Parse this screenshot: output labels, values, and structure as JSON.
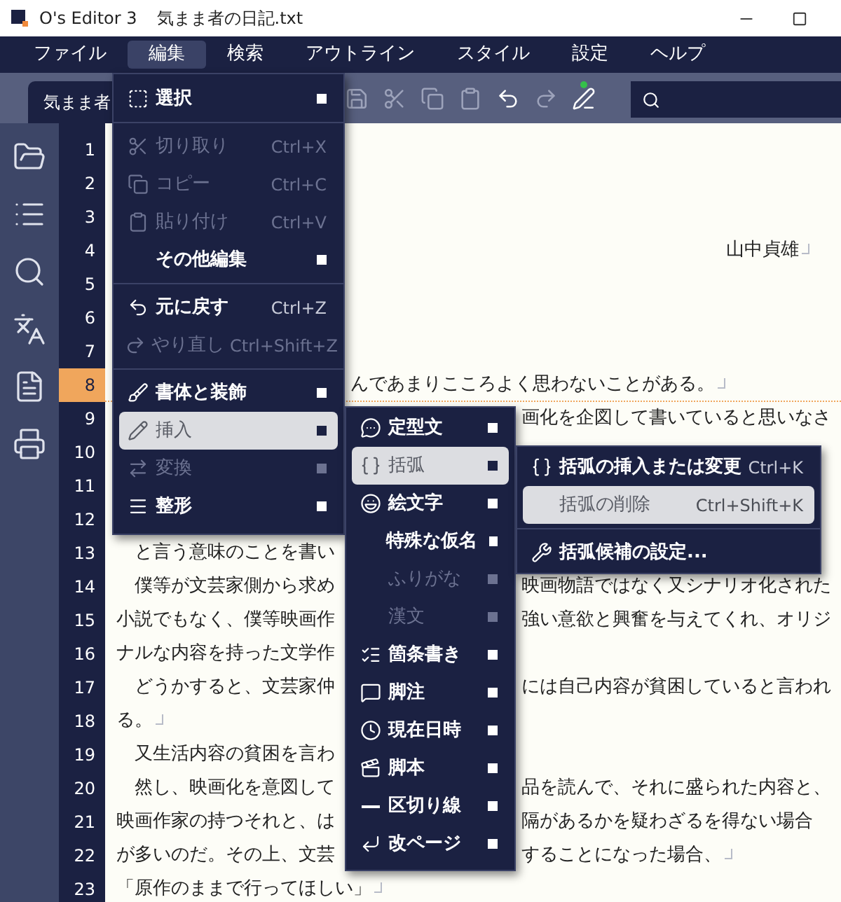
{
  "window": {
    "title": "O's Editor 3",
    "document": "気まま者の日記.txt"
  },
  "menu_bar": [
    {
      "label": "ファイル",
      "selected": false
    },
    {
      "label": "編集",
      "selected": true
    },
    {
      "label": "検索",
      "selected": false
    },
    {
      "label": "アウトライン",
      "selected": false
    },
    {
      "label": "スタイル",
      "selected": false
    },
    {
      "label": "設定",
      "selected": false
    },
    {
      "label": "ヘルプ",
      "selected": false
    }
  ],
  "tab": {
    "label": "気まま者"
  },
  "toolbar": [
    {
      "disabled": true
    },
    {
      "disabled": true
    },
    {
      "disabled": true
    },
    {
      "disabled": true
    },
    {
      "disabled": false
    },
    {
      "disabled": true
    },
    {
      "disabled": false
    }
  ],
  "editor": {
    "lines": [
      {
        "number": "1",
        "current": false
      },
      {
        "number": "2",
        "current": false
      },
      {
        "number": "3",
        "current": false
      },
      {
        "number": "4",
        "current": false,
        "end": "山中貞雄",
        "eol": true,
        "right_aligned": true
      },
      {
        "number": "5",
        "current": false
      },
      {
        "number": "6",
        "current": false
      },
      {
        "number": "7",
        "current": false
      },
      {
        "number": "8",
        "current": true,
        "end": "んであまりこころよく思わないことがある。",
        "eol": true
      },
      {
        "number": "9",
        "current": false,
        "end": "画化を企図して書いていると思いなさ"
      },
      {
        "number": "10",
        "current": false
      },
      {
        "number": "11",
        "current": false
      },
      {
        "number": "12",
        "current": false
      },
      {
        "number": "13",
        "current": false,
        "start": "　と言う意味のことを書い"
      },
      {
        "number": "14",
        "current": false,
        "start": "　僕等が文芸家側から求め",
        "end": "映画物語ではなく又シナリオ化された"
      },
      {
        "number": "15",
        "current": false,
        "start": "小説でもなく、僕等映画作",
        "end": "強い意欲と興奮を与えてくれ、オリジ"
      },
      {
        "number": "16",
        "current": false,
        "start": "ナルな内容を持った文学作"
      },
      {
        "number": "17",
        "current": false,
        "start": "　どうかすると、文芸家仲",
        "end": "には自己内容が貧困していると言われ"
      },
      {
        "number": "18",
        "current": false,
        "start": "る。",
        "eol": true
      },
      {
        "number": "19",
        "current": false,
        "start": "　又生活内容の貧困を言わ"
      },
      {
        "number": "20",
        "current": false,
        "start": "　然し、映画化を意図して",
        "end": "品を読んで、それに盛られた内容と、"
      },
      {
        "number": "21",
        "current": false,
        "start": "映画作家の持つそれと、は",
        "end": "隔があるかを疑わざるを得ない場合"
      },
      {
        "number": "22",
        "current": false,
        "start": "が多いのだ。その上、文芸",
        "end": "することになった場合、",
        "eol": true
      },
      {
        "number": "23",
        "current": false,
        "start": "「原作のままで行ってほしい」",
        "eol": true
      }
    ]
  },
  "menus": [
    {
      "items": [
        {
          "kind": "item",
          "label": "選択",
          "submenu": true,
          "disabled": false,
          "selected": false
        },
        {
          "kind": "separator"
        },
        {
          "kind": "item",
          "label": "切り取り",
          "shortcut": "Ctrl+X",
          "disabled": true,
          "selected": false
        },
        {
          "kind": "item",
          "label": "コピー",
          "shortcut": "Ctrl+C",
          "disabled": true,
          "selected": false
        },
        {
          "kind": "item",
          "label": "貼り付け",
          "shortcut": "Ctrl+V",
          "disabled": true,
          "selected": false
        },
        {
          "kind": "item",
          "label": "その他編集",
          "submenu": true,
          "disabled": false,
          "selected": false
        },
        {
          "kind": "separator"
        },
        {
          "kind": "item",
          "label": "元に戻す",
          "shortcut": "Ctrl+Z",
          "disabled": false,
          "selected": false
        },
        {
          "kind": "item",
          "label": "やり直し",
          "shortcut": "Ctrl+Shift+Z",
          "disabled": true,
          "selected": false
        },
        {
          "kind": "separator"
        },
        {
          "kind": "item",
          "label": "書体と装飾",
          "submenu": true,
          "disabled": false,
          "selected": false
        },
        {
          "kind": "item",
          "label": "挿入",
          "submenu": true,
          "disabled": false,
          "selected": true
        },
        {
          "kind": "item",
          "label": "変換",
          "submenu": true,
          "disabled": true,
          "selected": false
        },
        {
          "kind": "item",
          "label": "整形",
          "submenu": true,
          "disabled": false,
          "selected": false
        }
      ]
    },
    {
      "items": [
        {
          "kind": "item",
          "label": "定型文",
          "submenu": true,
          "disabled": false,
          "selected": false
        },
        {
          "kind": "item",
          "label": "括弧",
          "submenu": true,
          "disabled": false,
          "selected": true
        },
        {
          "kind": "item",
          "label": "絵文字",
          "submenu": true,
          "disabled": false,
          "selected": false
        },
        {
          "kind": "item",
          "label": "特殊な仮名",
          "submenu": true,
          "disabled": false,
          "selected": false
        },
        {
          "kind": "item",
          "label": "ふりがな",
          "submenu": true,
          "disabled": true,
          "selected": false
        },
        {
          "kind": "item",
          "label": "漢文",
          "submenu": true,
          "disabled": true,
          "selected": false
        },
        {
          "kind": "item",
          "label": "箇条書き",
          "submenu": true,
          "disabled": false,
          "selected": false
        },
        {
          "kind": "item",
          "label": "脚注",
          "submenu": true,
          "disabled": false,
          "selected": false
        },
        {
          "kind": "item",
          "label": "現在日時",
          "submenu": true,
          "disabled": false,
          "selected": false
        },
        {
          "kind": "item",
          "label": "脚本",
          "submenu": true,
          "disabled": false,
          "selected": false
        },
        {
          "kind": "item",
          "label": "区切り線",
          "submenu": true,
          "disabled": false,
          "selected": false
        },
        {
          "kind": "item",
          "label": "改ページ",
          "submenu": true,
          "disabled": false,
          "selected": false
        }
      ]
    },
    {
      "items": [
        {
          "kind": "item",
          "label": "括弧の挿入または変更",
          "shortcut": "Ctrl+K",
          "disabled": false,
          "selected": false
        },
        {
          "kind": "item",
          "label": "括弧の削除",
          "shortcut": "Ctrl+Shift+K",
          "disabled": true,
          "selected": true
        },
        {
          "kind": "separator"
        },
        {
          "kind": "item",
          "label": "括弧候補の設定...",
          "disabled": false,
          "selected": false
        }
      ]
    }
  ]
}
